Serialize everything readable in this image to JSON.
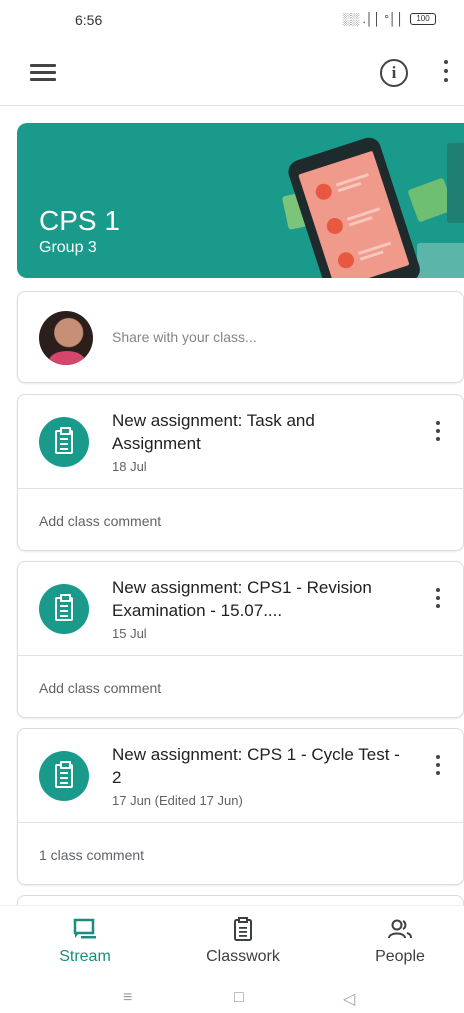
{
  "status_bar": {
    "time": "6:56",
    "signal": "░░ .││ °││",
    "battery": "100"
  },
  "app_bar": {
    "info_glyph": "i"
  },
  "banner": {
    "class_name": "CPS 1",
    "section": "Group 3",
    "color": "#1a9a8b"
  },
  "share": {
    "placeholder": "Share with your class..."
  },
  "posts": [
    {
      "title": "New assignment: Task and Assignment",
      "date": "18 Jul",
      "comment": "Add class comment"
    },
    {
      "title": "New assignment: CPS1 - Revision Examination - 15.07....",
      "date": "15 Jul",
      "comment": "Add class comment"
    },
    {
      "title": "New assignment: CPS 1 - Cycle Test - 2",
      "date": "17 Jun (Edited 17 Jun)",
      "comment": "1 class comment"
    }
  ],
  "bottom_nav": {
    "stream": "Stream",
    "classwork": "Classwork",
    "people": "People",
    "active_color": "#1a8d80"
  },
  "system_nav": {
    "menu": "≡",
    "home": "□",
    "back": "◁"
  }
}
